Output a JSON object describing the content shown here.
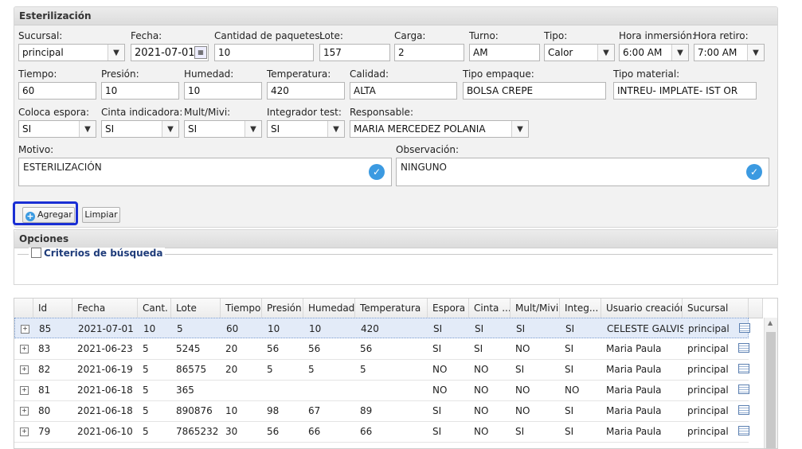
{
  "form": {
    "title": "Esterilización",
    "labels": {
      "sucursal": "Sucursal:",
      "fecha": "Fecha:",
      "cantidad": "Cantidad de paquetes:",
      "lote": "Lote:",
      "carga": "Carga:",
      "turno": "Turno:",
      "tipo": "Tipo:",
      "hora_inmersion": "Hora inmersión:",
      "hora_retiro": "Hora retiro:",
      "tiempo": "Tiempo:",
      "presion": "Presión:",
      "humedad": "Humedad:",
      "temperatura": "Temperatura:",
      "calidad": "Calidad:",
      "tipo_empaque": "Tipo empaque:",
      "tipo_material": "Tipo material:",
      "coloca_espora": "Coloca espora:",
      "cinta_indicadora": "Cinta indicadora:",
      "mult_mivi": "Mult/Mivi:",
      "integrador_test": "Integrador test:",
      "responsable": "Responsable:",
      "motivo": "Motivo:",
      "observacion": "Observación:"
    },
    "values": {
      "sucursal": "principal",
      "fecha": "2021-07-01",
      "cantidad": "10",
      "lote": "157",
      "carga": "2",
      "turno": "AM",
      "tipo": "Calor",
      "hora_inmersion": "6:00 AM",
      "hora_retiro": "7:00 AM",
      "tiempo": "60",
      "presion": "10",
      "humedad": "10",
      "temperatura": "420",
      "calidad": "ALTA",
      "tipo_empaque": "BOLSA CREPE",
      "tipo_material": "INTREU- IMPLATE- IST OR",
      "coloca_espora": "SI",
      "cinta_indicadora": "SI",
      "mult_mivi": "SI",
      "integrador_test": "SI",
      "responsable": "MARIA MERCEDEZ POLANIA",
      "motivo": "ESTERILIZACIÓN",
      "observacion": "NINGUNO"
    },
    "buttons": {
      "agregar": "Agregar",
      "limpiar": "Limpiar"
    },
    "highlight_color": "#1a2fd4"
  },
  "opciones": {
    "title": "Opciones",
    "criterios_label": "Criterios de búsqueda"
  },
  "grid": {
    "columns": [
      "Id",
      "Fecha",
      "Cant.",
      "Lote",
      "Tiempo",
      "Presión",
      "Humedad",
      "Temperatura",
      "Espora",
      "Cinta ...",
      "Mult/Mivi",
      "Integ...",
      "Usuario creación",
      "Sucursal"
    ],
    "rows": [
      [
        "85",
        "2021-07-01",
        "10",
        "5",
        "60",
        "10",
        "10",
        "420",
        "SI",
        "SI",
        "SI",
        "SI",
        "CELESTE GALVIS",
        "principal"
      ],
      [
        "83",
        "2021-06-23",
        "5",
        "5245",
        "20",
        "56",
        "56",
        "56",
        "SI",
        "SI",
        "NO",
        "SI",
        "Maria Paula",
        "principal"
      ],
      [
        "82",
        "2021-06-19",
        "5",
        "86575",
        "20",
        "5",
        "5",
        "5",
        "NO",
        "NO",
        "SI",
        "SI",
        "Maria Paula",
        "principal"
      ],
      [
        "81",
        "2021-06-18",
        "5",
        "365",
        "",
        "",
        "",
        "",
        "NO",
        "NO",
        "NO",
        "NO",
        "Maria Paula",
        "principal"
      ],
      [
        "80",
        "2021-06-18",
        "5",
        "890876",
        "10",
        "98",
        "67",
        "89",
        "SI",
        "NO",
        "NO",
        "SI",
        "Maria Paula",
        "principal"
      ],
      [
        "79",
        "2021-06-10",
        "5",
        "7865232",
        "30",
        "56",
        "66",
        "66",
        "SI",
        "NO",
        "SI",
        "SI",
        "Maria Paula",
        "principal"
      ]
    ]
  }
}
